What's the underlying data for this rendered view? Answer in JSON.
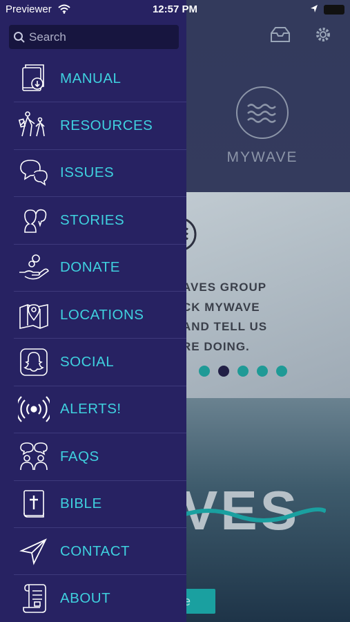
{
  "status_bar": {
    "carrier": "Previewer",
    "time": "12:57 PM"
  },
  "drawer": {
    "search": {
      "placeholder": "Search"
    },
    "items": [
      {
        "label": "MANUAL",
        "icon": "manual-icon"
      },
      {
        "label": "RESOURCES",
        "icon": "resources-icon"
      },
      {
        "label": "ISSUES",
        "icon": "issues-icon"
      },
      {
        "label": "STORIES",
        "icon": "stories-icon"
      },
      {
        "label": "DONATE",
        "icon": "donate-icon"
      },
      {
        "label": "LOCATIONS",
        "icon": "locations-icon"
      },
      {
        "label": "SOCIAL",
        "icon": "social-icon"
      },
      {
        "label": "ALERTS!",
        "icon": "alerts-icon"
      },
      {
        "label": "FAQS",
        "icon": "faqs-icon"
      },
      {
        "label": "BIBLE",
        "icon": "bible-icon"
      },
      {
        "label": "CONTACT",
        "icon": "contact-icon"
      },
      {
        "label": "ABOUT",
        "icon": "about-icon"
      }
    ]
  },
  "background": {
    "logo_text": "MYWAVE",
    "card_message": "AVES GROUP\nCK MYWAVE\nAND TELL US\nRE DOING.",
    "carousel": {
      "count": 5,
      "active_index": 1
    },
    "brand_text": "VES",
    "button_fragment": "e"
  },
  "colors": {
    "drawer_bg": "#272262",
    "accent": "#3fd1df",
    "search_bg": "#17153f",
    "teal": "#1f9a96"
  }
}
